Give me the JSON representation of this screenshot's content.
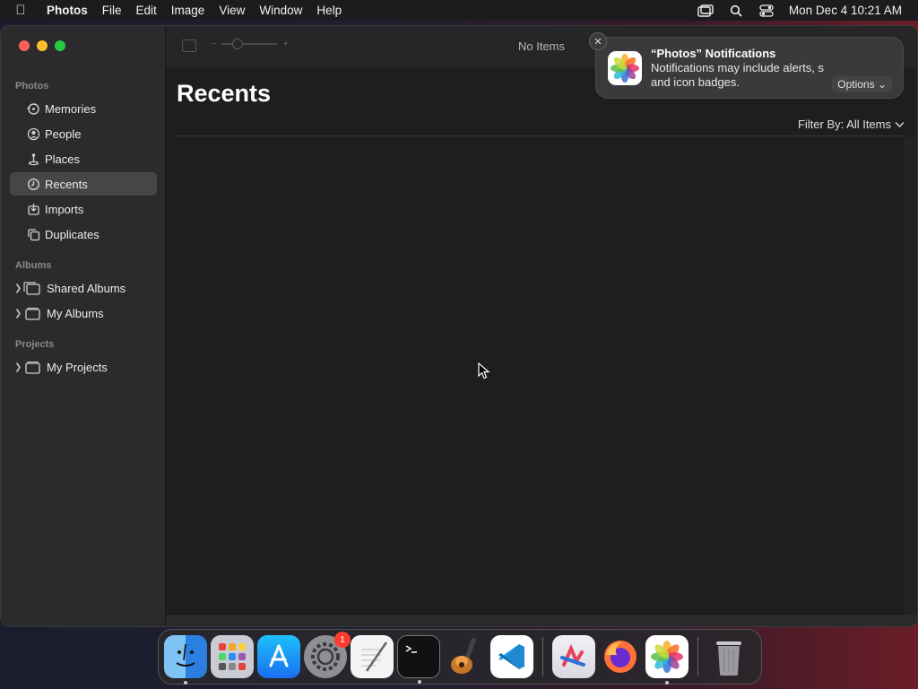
{
  "menubar": {
    "app_name": "Photos",
    "menus": [
      "File",
      "Edit",
      "Image",
      "View",
      "Window",
      "Help"
    ],
    "clock": "Mon Dec 4  10:21 AM"
  },
  "sidebar": {
    "sections": {
      "photos": "Photos",
      "albums": "Albums",
      "projects": "Projects"
    },
    "items": [
      {
        "label": "Memories",
        "icon": "memories-icon"
      },
      {
        "label": "People",
        "icon": "people-icon"
      },
      {
        "label": "Places",
        "icon": "places-icon"
      },
      {
        "label": "Recents",
        "icon": "recents-icon",
        "active": true
      },
      {
        "label": "Imports",
        "icon": "imports-icon"
      },
      {
        "label": "Duplicates",
        "icon": "duplicates-icon"
      }
    ],
    "albums": [
      {
        "label": "Shared Albums",
        "icon": "shared-albums-icon"
      },
      {
        "label": "My Albums",
        "icon": "folder-icon"
      }
    ],
    "projects": [
      {
        "label": "My Projects",
        "icon": "folder-icon"
      }
    ]
  },
  "toolbar": {
    "zoom_minus": "−",
    "zoom_plus": "+",
    "status": "No Items"
  },
  "main": {
    "title": "Recents",
    "filter": "Filter By: All Items"
  },
  "notification": {
    "title": "“Photos” Notifications",
    "body_line1": "Notifications may include alerts, s",
    "body_line2": "and icon badges.",
    "options": "Options",
    "close": "✕"
  },
  "dock": {
    "apps": [
      {
        "name": "Finder",
        "icon": "finder-icon",
        "running": true
      },
      {
        "name": "Launchpad",
        "icon": "launchpad-icon"
      },
      {
        "name": "App Store",
        "icon": "app-store-icon"
      },
      {
        "name": "System Settings",
        "icon": "settings-icon",
        "badge": "1"
      },
      {
        "name": "TextEdit",
        "icon": "textedit-icon"
      },
      {
        "name": "Terminal",
        "icon": "terminal-icon",
        "running": true
      },
      {
        "name": "GarageBand",
        "icon": "garageband-icon"
      },
      {
        "name": "Visual Studio Code",
        "icon": "vscode-icon"
      },
      {
        "name": "Stocks",
        "icon": "app-icon"
      },
      {
        "name": "Firefox",
        "icon": "firefox-icon"
      },
      {
        "name": "Photos",
        "icon": "photos-icon",
        "running": true
      },
      {
        "name": "Trash",
        "icon": "trash-icon"
      }
    ]
  },
  "colors": {
    "accent_active": "#464649",
    "close": "#fe5f57",
    "minimize": "#febc2e",
    "maximize": "#28c840",
    "badge": "#ff3b30"
  }
}
